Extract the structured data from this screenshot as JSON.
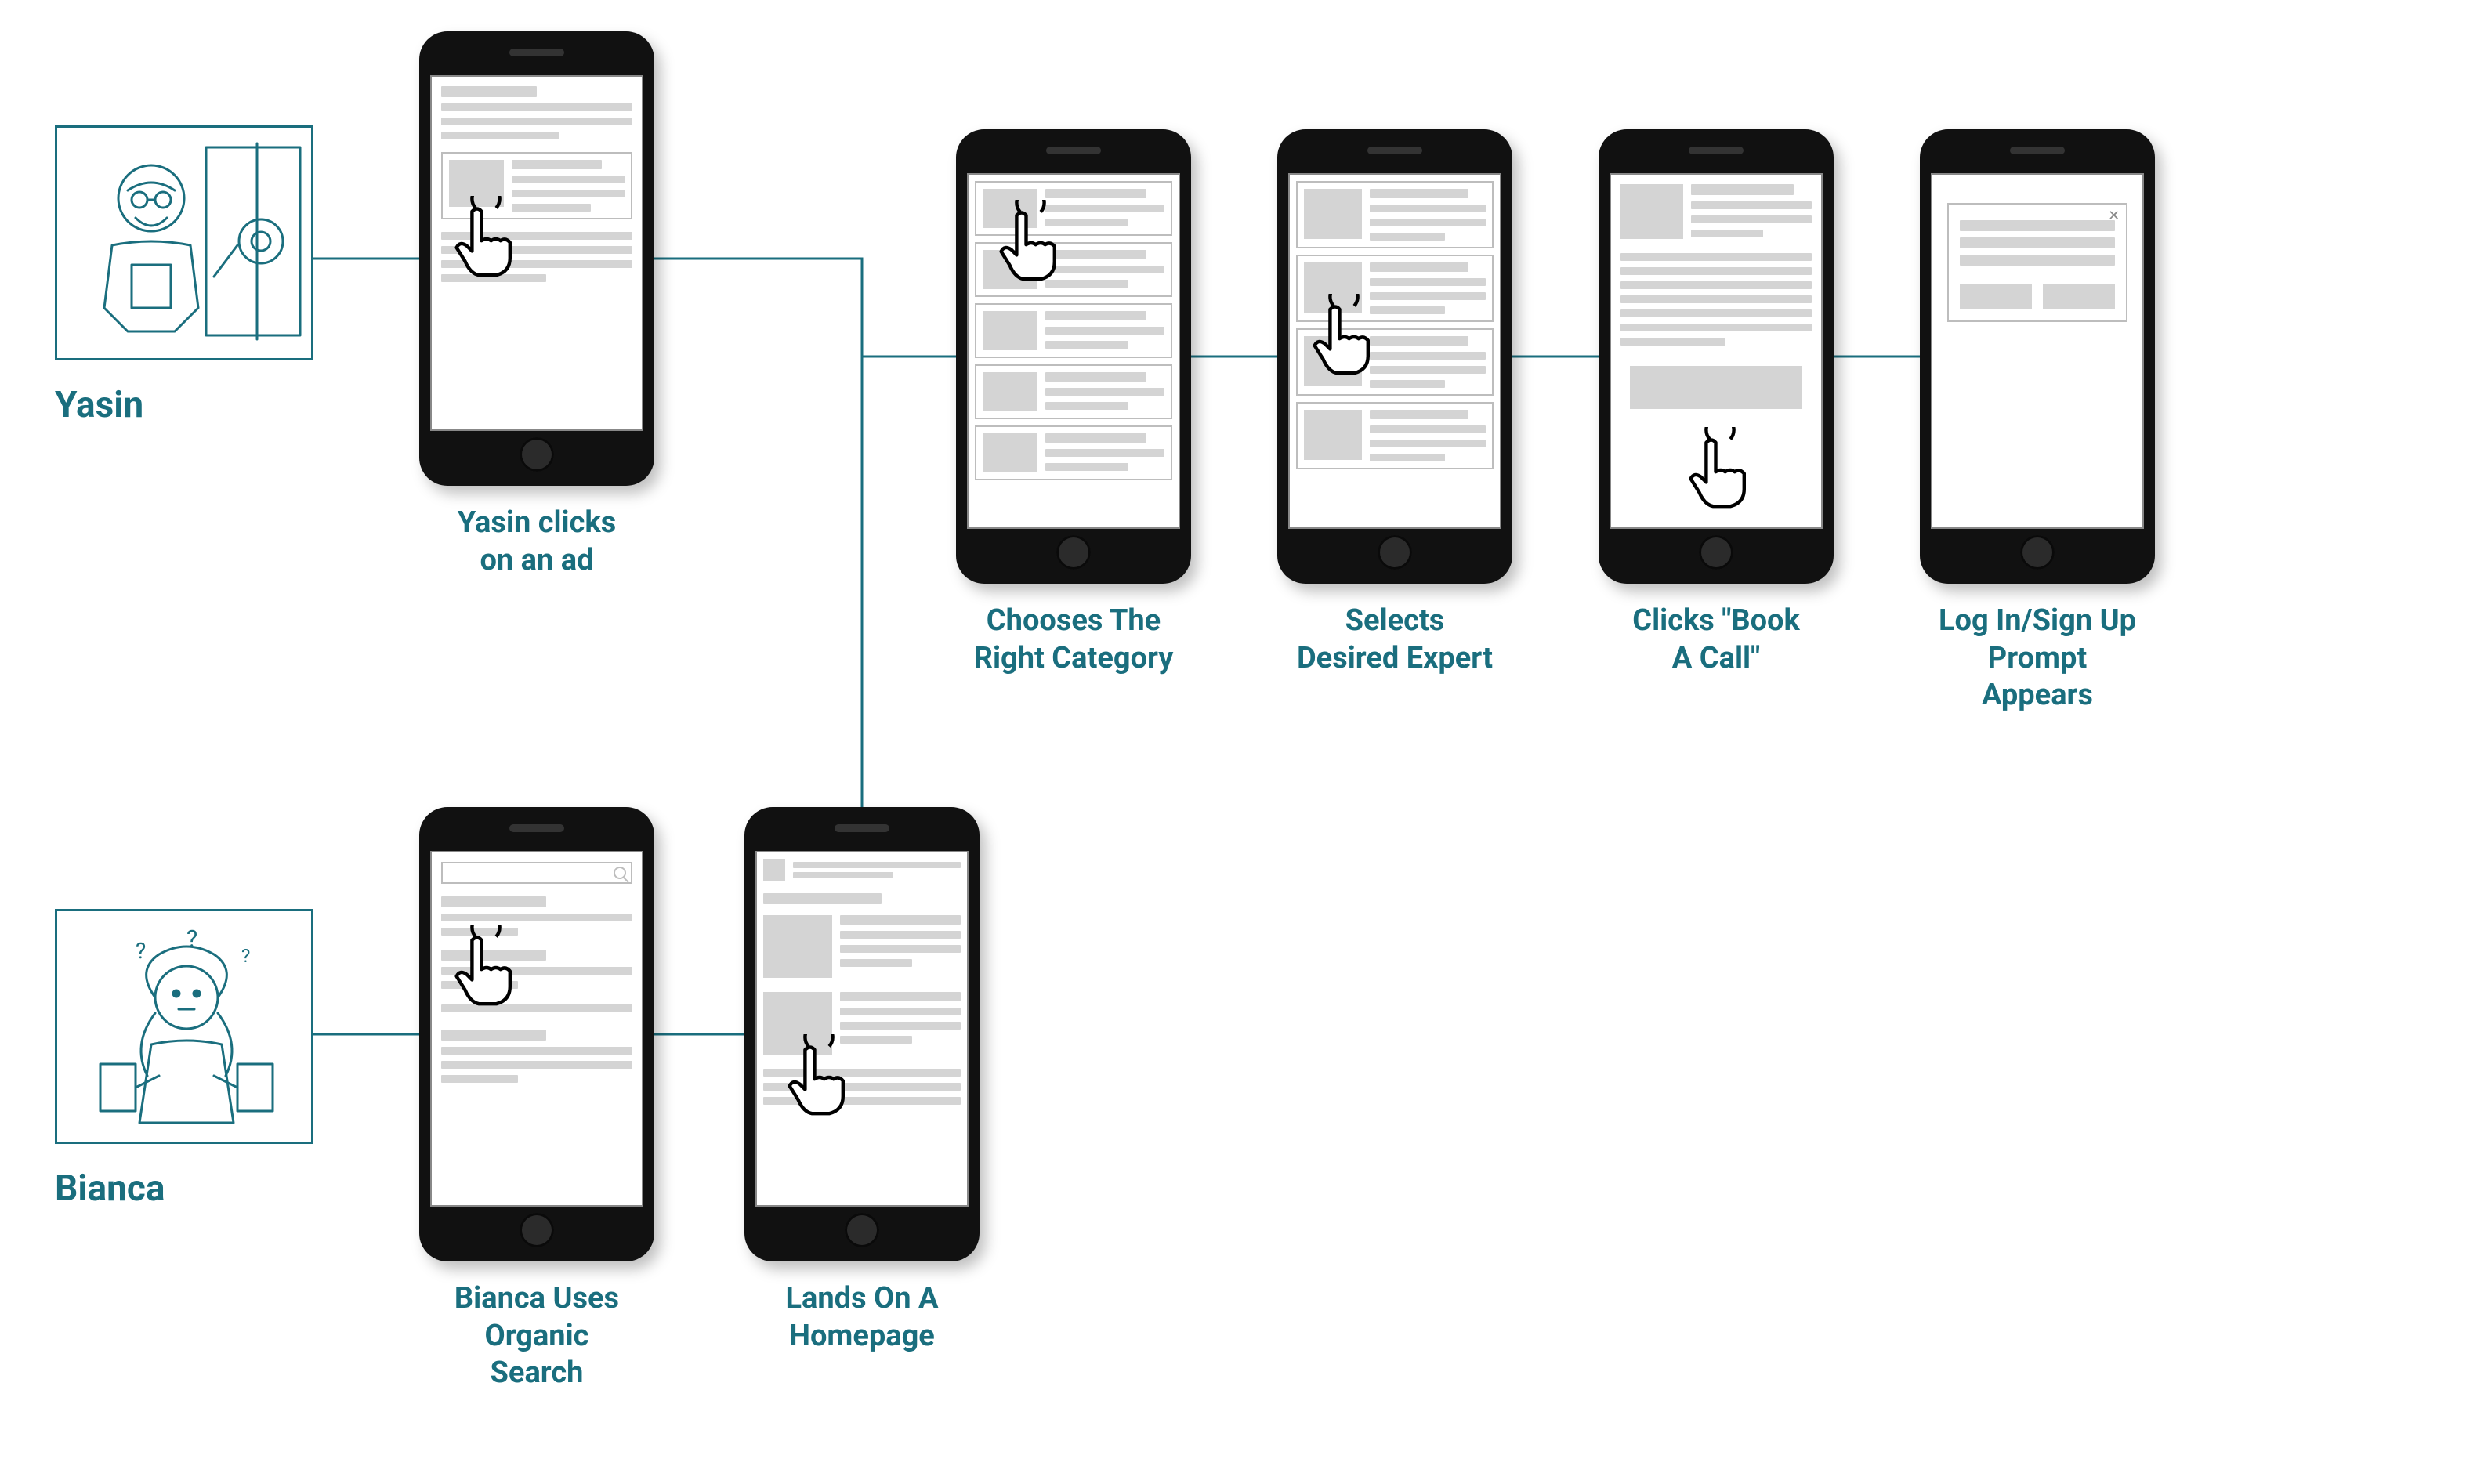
{
  "personas": {
    "yasin": {
      "label": "Yasin"
    },
    "bianca": {
      "label": "Bianca"
    }
  },
  "phones": {
    "yasin_ad": {
      "caption_line1": "Yasin clicks",
      "caption_line2": "on an ad"
    },
    "bianca_search": {
      "caption_line1": "Bianca Uses",
      "caption_line2": "Organic",
      "caption_line3": "Search"
    },
    "homepage": {
      "caption_line1": "Lands On A",
      "caption_line2": "Homepage"
    },
    "category": {
      "caption_line1": "Chooses The",
      "caption_line2": "Right Category"
    },
    "expert": {
      "caption_line1": "Selects",
      "caption_line2": "Desired Expert"
    },
    "book": {
      "caption_line1": "Clicks \"Book",
      "caption_line2": "A Call\""
    },
    "login": {
      "caption_line1": "Log In/Sign Up",
      "caption_line2": "Prompt",
      "caption_line3": "Appears"
    }
  },
  "colors": {
    "teal": "#1a6e7e",
    "gray": "#bdbdbd"
  }
}
